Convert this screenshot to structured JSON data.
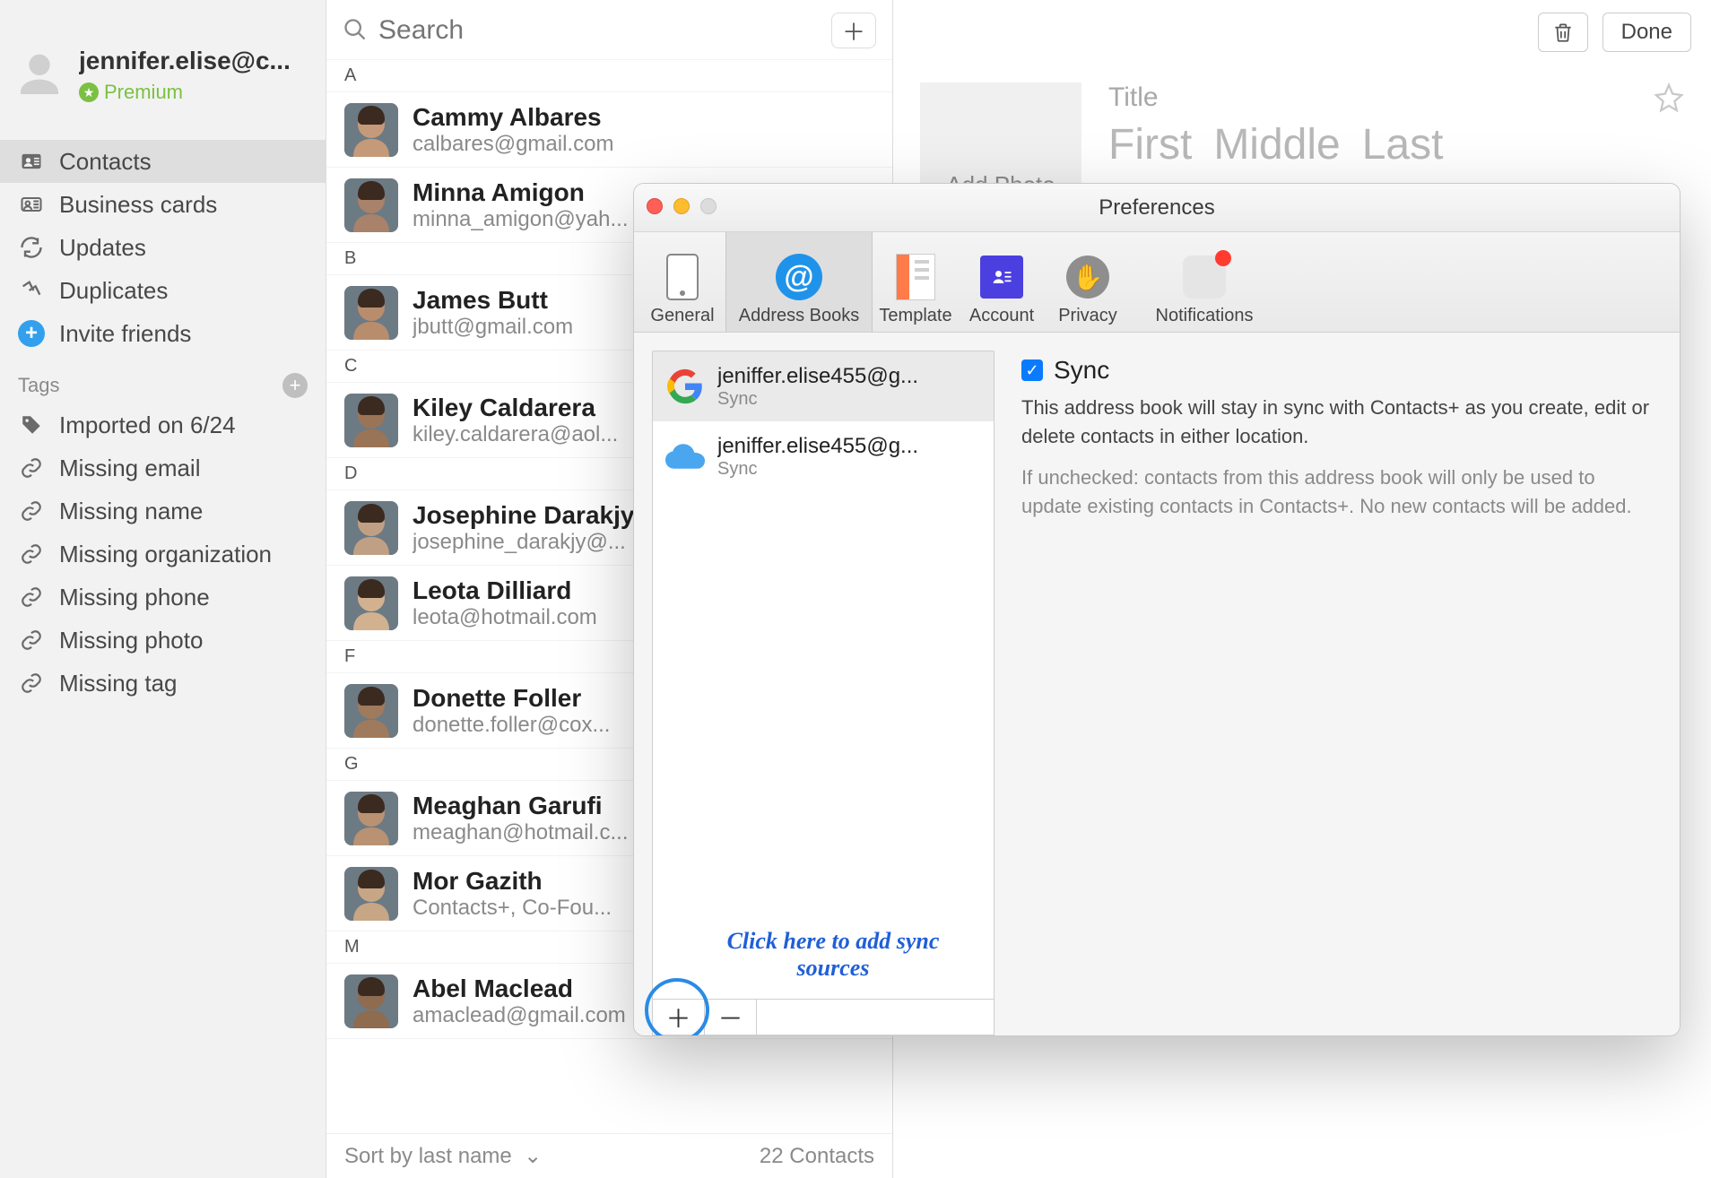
{
  "sidebar": {
    "account_email": "jennifer.elise@c...",
    "premium_label": "Premium",
    "nav": [
      {
        "label": "Contacts",
        "icon": "contacts-icon",
        "selected": true
      },
      {
        "label": "Business cards",
        "icon": "business-cards-icon",
        "selected": false
      },
      {
        "label": "Updates",
        "icon": "updates-icon",
        "selected": false
      },
      {
        "label": "Duplicates",
        "icon": "duplicates-icon",
        "selected": false
      },
      {
        "label": "Invite friends",
        "icon": "invite-icon",
        "selected": false
      }
    ],
    "tags_header": "Tags",
    "tags": [
      {
        "label": "Imported on 6/24",
        "icon": "tag-icon"
      },
      {
        "label": "Missing email",
        "icon": "link-icon"
      },
      {
        "label": "Missing name",
        "icon": "link-icon"
      },
      {
        "label": "Missing organization",
        "icon": "link-icon"
      },
      {
        "label": "Missing phone",
        "icon": "link-icon"
      },
      {
        "label": "Missing photo",
        "icon": "link-icon"
      },
      {
        "label": "Missing tag",
        "icon": "link-icon"
      }
    ]
  },
  "list": {
    "search_placeholder": "Search",
    "sort_label": "Sort by last name",
    "count_label": "22 Contacts",
    "sections": [
      {
        "letter": "A",
        "rows": [
          {
            "name": "Cammy Albares",
            "sub": "calbares@gmail.com"
          },
          {
            "name": "Minna Amigon",
            "sub": "minna_amigon@yah..."
          }
        ]
      },
      {
        "letter": "B",
        "rows": [
          {
            "name": "James Butt",
            "sub": "jbutt@gmail.com"
          }
        ]
      },
      {
        "letter": "C",
        "rows": [
          {
            "name": "Kiley Caldarera",
            "sub": "kiley.caldarera@aol..."
          }
        ]
      },
      {
        "letter": "D",
        "rows": [
          {
            "name": "Josephine Darakjy",
            "sub": "josephine_darakjy@..."
          },
          {
            "name": "Leota Dilliard",
            "sub": "leota@hotmail.com"
          }
        ]
      },
      {
        "letter": "F",
        "rows": [
          {
            "name": "Donette Foller",
            "sub": "donette.foller@cox..."
          }
        ]
      },
      {
        "letter": "G",
        "rows": [
          {
            "name": "Meaghan Garufi",
            "sub": "meaghan@hotmail.c..."
          },
          {
            "name": "Mor Gazith",
            "sub": "Contacts+, Co-Fou..."
          }
        ]
      },
      {
        "letter": "M",
        "rows": [
          {
            "name": "Abel Maclead",
            "sub": "amaclead@gmail.com"
          }
        ]
      }
    ]
  },
  "detail": {
    "done_label": "Done",
    "add_photo_label": "Add Photo",
    "title_placeholder": "Title",
    "first_placeholder": "First",
    "middle_placeholder": "Middle",
    "last_placeholder": "Last"
  },
  "prefs": {
    "window_title": "Preferences",
    "tabs": {
      "general": "General",
      "address_books": "Address Books",
      "template": "Template",
      "account": "Account",
      "privacy": "Privacy",
      "notifications": "Notifications"
    },
    "books": [
      {
        "name": "jeniffer.elise455@g...",
        "sub": "Sync",
        "provider": "google",
        "selected": true
      },
      {
        "name": "jeniffer.elise455@g...",
        "sub": "Sync",
        "provider": "icloud",
        "selected": false
      }
    ],
    "callout": "Click here to add sync sources",
    "sync_label": "Sync",
    "sync_checked": true,
    "sync_desc": "This address book will stay in sync with Contacts+ as you create, edit or delete contacts in either location.",
    "sync_note": "If unchecked: contacts from this address book will only be used to update existing contacts in Contacts+. No new contacts will be added."
  },
  "avatar_colors": [
    "#c49a7a",
    "#a8826a",
    "#b88d6d",
    "#9a7456",
    "#c0a084",
    "#d2b191",
    "#a07a5c",
    "#b99273",
    "#c7a686",
    "#8f6b50"
  ]
}
